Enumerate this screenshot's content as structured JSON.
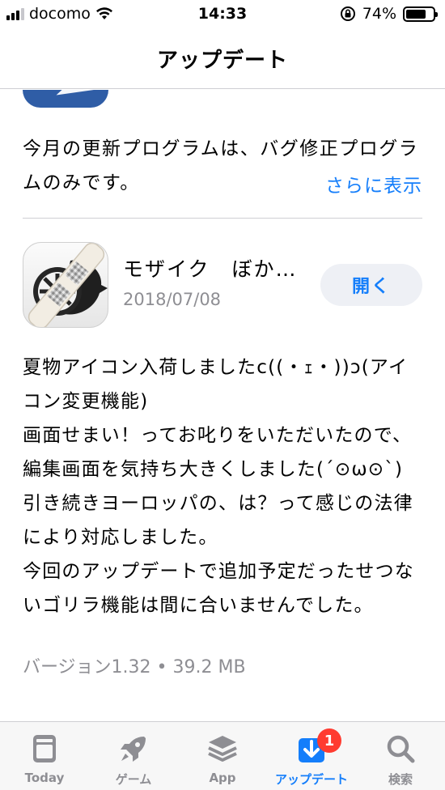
{
  "status_bar": {
    "carrier": "docomo",
    "time": "14:33",
    "battery_percent": "74%",
    "battery_level": 0.74
  },
  "nav": {
    "title": "アップデート"
  },
  "previous_update": {
    "notes": "今月の更新プログラムは、バグ修正プログラムのみです。",
    "more_label": "さらに表示"
  },
  "update": {
    "app_name": "モザイク　ぼか…",
    "date": "2018/07/08",
    "open_label": "開く",
    "notes_lines": [
      "夏物アイコン入荷しましたc((・ｪ・))ↄ(アイ",
      "コン変更機能)",
      "画面せまい！ってお叱りをいただいたので、",
      "編集画面を気持ち大きくしました(´⊙ω⊙`)",
      "引き続きヨーロッパの、は？って感じの法律",
      "により対応しました。",
      "今回のアップデートで追加予定だったせつな",
      "いゴリラ機能は間に合いませんでした。"
    ],
    "version_info": "バージョン1.32 • 39.2 MB"
  },
  "tabbar": {
    "tabs": [
      {
        "label": "Today",
        "icon": "today-icon"
      },
      {
        "label": "ゲーム",
        "icon": "rocket-icon"
      },
      {
        "label": "App",
        "icon": "layers-icon"
      },
      {
        "label": "アップデート",
        "icon": "download-icon",
        "badge": "1"
      },
      {
        "label": "検索",
        "icon": "search-icon"
      }
    ],
    "active_color": "#147efb",
    "inactive_color": "#8e8e93"
  }
}
